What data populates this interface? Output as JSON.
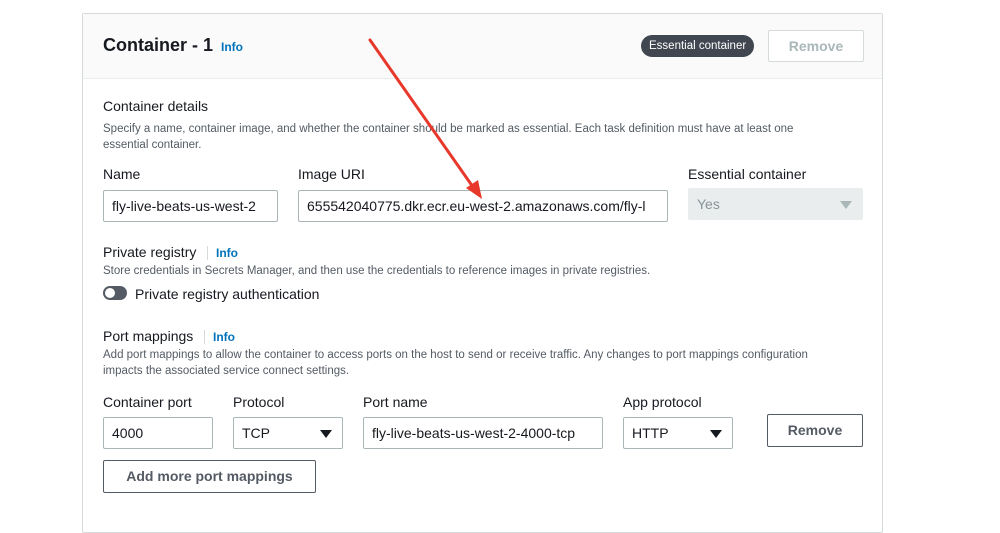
{
  "container": {
    "title": "Container - 1",
    "info_label": "Info",
    "essential_badge": "Essential container",
    "remove_label": "Remove"
  },
  "details": {
    "heading": "Container details",
    "description_line1": "Specify a name, container image, and whether the container should be marked as essential. Each task definition must have at least one",
    "description_line2": "essential container.",
    "name_label": "Name",
    "name_value": "fly-live-beats-us-west-2",
    "image_label": "Image URI",
    "image_value": "655542040775.dkr.ecr.eu-west-2.amazonaws.com/fly-l",
    "essential_label": "Essential container",
    "essential_value": "Yes"
  },
  "private_registry": {
    "heading": "Private registry",
    "info_label": "Info",
    "description": "Store credentials in Secrets Manager, and then use the credentials to reference images in private registries.",
    "toggle_label": "Private registry authentication"
  },
  "port_mappings": {
    "heading": "Port mappings",
    "info_label": "Info",
    "description_line1": "Add port mappings to allow the container to access ports on the host to send or receive traffic. Any changes to port mappings configuration",
    "description_line2": "impacts the associated service connect settings.",
    "container_port_label": "Container port",
    "container_port_value": "4000",
    "protocol_label": "Protocol",
    "protocol_value": "TCP",
    "port_name_label": "Port name",
    "port_name_value": "fly-live-beats-us-west-2-4000-tcp",
    "app_protocol_label": "App protocol",
    "app_protocol_value": "HTTP",
    "remove_label": "Remove",
    "add_more_label": "Add more port mappings"
  },
  "colors": {
    "link": "#0073bb",
    "badge_bg": "#414750",
    "annotation_arrow": "#e8372b"
  }
}
